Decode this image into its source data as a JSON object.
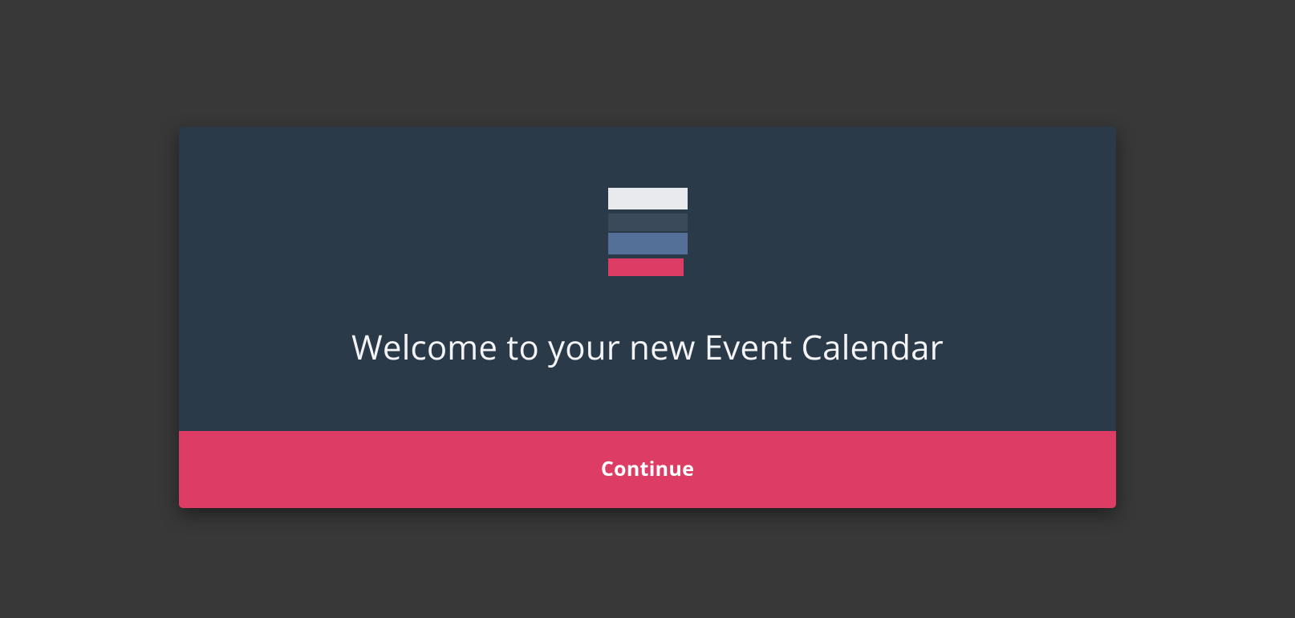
{
  "card": {
    "title": "Welcome to your new Event Calendar",
    "continue_label": "Continue"
  },
  "colors": {
    "page_bg": "#383838",
    "card_bg": "#2a3a49",
    "accent": "#dd3d64",
    "text": "#f4f4f6"
  }
}
